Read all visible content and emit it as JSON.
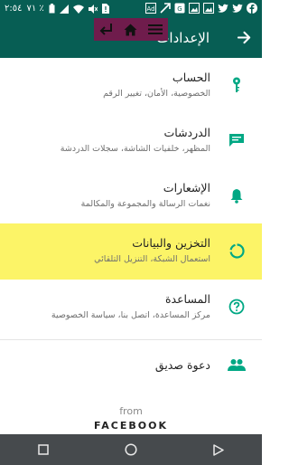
{
  "status_bar": {
    "time": "٢:٥٤",
    "battery": "٧١ ٪",
    "left_icons": [
      "battery-icon",
      "signal-icon",
      "wifi-icon",
      "mute-icon",
      "sim-alert-icon"
    ],
    "right_icons": [
      "facebook-icon",
      "twitter-icon",
      "twitter-icon",
      "gallery-icon",
      "gallery-icon",
      "translate-icon",
      "arrow-icon",
      "ad-icon"
    ]
  },
  "app_bar": {
    "title": "الإعدادات",
    "back_icon": "arrow-forward-icon"
  },
  "overlay": {
    "icons": [
      "menu-icon",
      "home-icon",
      "back-return-icon"
    ]
  },
  "settings": {
    "items": [
      {
        "title": "الحساب",
        "subtitle": "الخصوصية، الأمان، تغيير الرقم",
        "icon": "key-icon"
      },
      {
        "title": "الدردشات",
        "subtitle": "المظهر، خلفيات الشاشة، سجلات الدردشة",
        "icon": "chat-icon"
      },
      {
        "title": "الإشعارات",
        "subtitle": "نغمات الرسالة والمجموعة والمكالمة",
        "icon": "bell-icon"
      },
      {
        "title": "التخزين والبيانات",
        "subtitle": "استعمال الشبكة، التنزيل التلقائي",
        "icon": "data-usage-icon",
        "highlighted": true
      },
      {
        "title": "المساعدة",
        "subtitle": "مركز المساعدة، اتصل بنا، سياسة الخصوصية",
        "icon": "help-icon"
      }
    ],
    "invite": {
      "title": "دعوة صديق",
      "icon": "people-icon"
    }
  },
  "footer": {
    "from": "from",
    "brand": "FACEBOOK"
  },
  "nav_bar": {
    "icons": [
      "recents-icon",
      "home-icon",
      "back-icon"
    ]
  },
  "colors": {
    "primary": "#075e54",
    "accent": "#00a884",
    "highlight": "#fcf467",
    "overlay": "#6f1c4c"
  }
}
